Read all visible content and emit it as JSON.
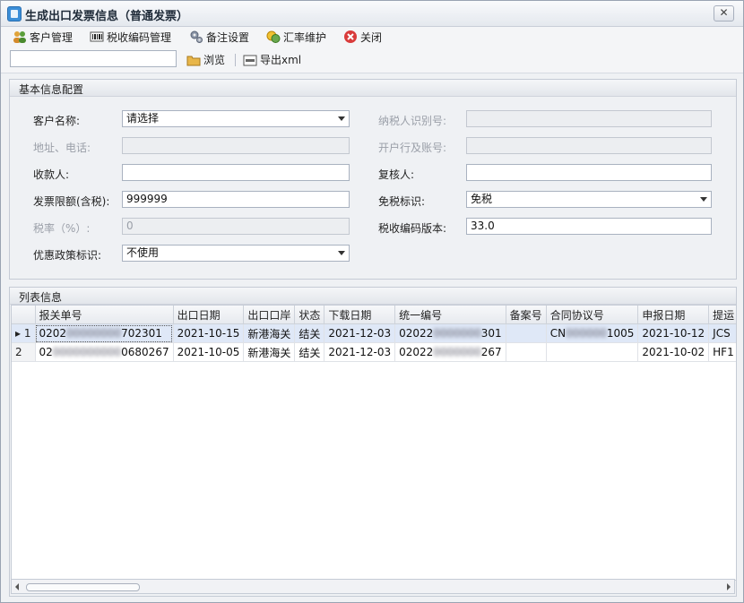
{
  "window": {
    "title": "生成出口发票信息（普通发票）",
    "close_glyph": "✕"
  },
  "menu": [
    {
      "label": "客户管理",
      "icon": "users-icon"
    },
    {
      "label": "税收编码管理",
      "icon": "barcode-icon"
    },
    {
      "label": "备注设置",
      "icon": "gears-icon"
    },
    {
      "label": "汇率维护",
      "icon": "coins-icon"
    },
    {
      "label": "关闭",
      "icon": "close-circle-icon"
    }
  ],
  "toolbar": {
    "path_value": "",
    "browse_label": "浏览",
    "export_label": "导出xml"
  },
  "basic": {
    "title": "基本信息配置",
    "customer_label": "客户名称:",
    "customer_value": "请选择",
    "taxpayer_label": "纳税人识别号:",
    "taxpayer_value": "",
    "address_label": "地址、电话:",
    "address_value": "",
    "bank_label": "开户行及账号:",
    "bank_value": "",
    "payee_label": "收款人:",
    "payee_value": "",
    "reviewer_label": "复核人:",
    "reviewer_value": "",
    "limit_label": "发票限额(含税):",
    "limit_value": "999999",
    "exempt_label": "免税标识:",
    "exempt_value": "免税",
    "rate_label": "税率（%）:",
    "rate_value": "0",
    "version_label": "税收编码版本:",
    "version_value": "33.0",
    "policy_label": "优惠政策标识:",
    "policy_value": "不使用"
  },
  "list": {
    "title": "列表信息",
    "columns": [
      "报关单号",
      "出口日期",
      "出口口岸",
      "状态",
      "下载日期",
      "统一编号",
      "备案号",
      "合同协议号",
      "申报日期",
      "提运"
    ],
    "rows": [
      {
        "index": "1",
        "marker": "▸",
        "customs_pre": "0202",
        "customs_post": "702301",
        "export_date": "2021-10-15",
        "port": "新港海关",
        "status": "结关",
        "download_date": "2021-12-03",
        "unified_pre": "02022",
        "unified_post": "301",
        "record_no": "",
        "contract_pre": "CN",
        "contract_post": "1005",
        "declare_date": "2021-10-12",
        "transport": "JCS"
      },
      {
        "index": "2",
        "marker": "",
        "customs_pre": "02",
        "customs_post": "0680267",
        "export_date": "2021-10-05",
        "port": "新港海关",
        "status": "结关",
        "download_date": "2021-12-03",
        "unified_pre": "02022",
        "unified_post": "267",
        "record_no": "",
        "contract_pre": "",
        "contract_post": "",
        "declare_date": "2021-10-02",
        "transport": "HF1"
      }
    ]
  },
  "colors": {
    "selected_row": "#dfe8f7",
    "accent": "#3b8ed8"
  }
}
